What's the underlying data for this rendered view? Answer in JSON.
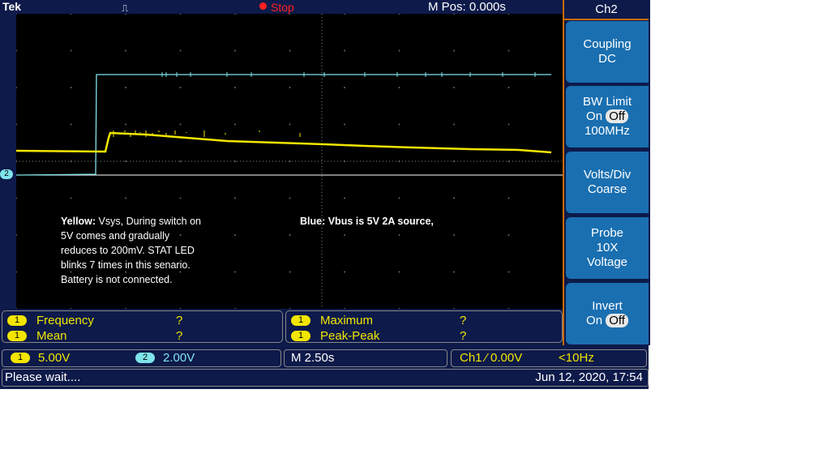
{
  "header": {
    "brand": "Tek",
    "run_state": "Stop",
    "m_pos": "M Pos: 0.000s",
    "trigger_glyph": "⎍"
  },
  "screen": {
    "ch2_marker": "2",
    "note_yellow_label": "Yellow:",
    "note_yellow_text": " Vsys, During switch on",
    "note_yellow_lines": [
      "5V comes and gradually",
      "reduces to 200mV. STAT LED",
      "blinks 7 times in this senario.",
      "Battery is not connected."
    ],
    "note_blue_label": "Blue:",
    "note_blue_text": " Vbus is 5V 2A source,"
  },
  "side_menu": {
    "title": "Ch2",
    "coupling": {
      "label": "Coupling",
      "value": "DC"
    },
    "bw_limit": {
      "label": "BW Limit",
      "on": "On",
      "off": "Off",
      "bw": "100MHz"
    },
    "volts_div": {
      "label": "Volts/Div",
      "value": "Coarse"
    },
    "probe": {
      "label": "Probe",
      "value": "10X",
      "type": "Voltage"
    },
    "invert": {
      "label": "Invert",
      "on": "On",
      "off": "Off"
    }
  },
  "measurements": {
    "left": [
      {
        "channel": "1",
        "name": "Frequency",
        "value": "?"
      },
      {
        "channel": "1",
        "name": "Mean",
        "value": "?"
      }
    ],
    "right": [
      {
        "channel": "1",
        "name": "Maximum",
        "value": "?"
      },
      {
        "channel": "1",
        "name": "Peak-Peak",
        "value": "?"
      }
    ]
  },
  "scale": {
    "ch1_badge": "1",
    "ch1_scale": "5.00V",
    "ch2_badge": "2",
    "ch2_scale": "2.00V",
    "timebase": "M 2.50s",
    "trigger_source": "Ch1",
    "trigger_slope": "⁄",
    "trigger_level": "0.00V",
    "trigger_freq": "<10Hz"
  },
  "status": {
    "message": "Please wait....",
    "datetime": "Jun 12, 2020, 17:54"
  },
  "colors": {
    "ch1": "#f2e600",
    "ch2": "#7fe3ea",
    "background": "#0d1a4a",
    "accent": "#c96b00"
  }
}
